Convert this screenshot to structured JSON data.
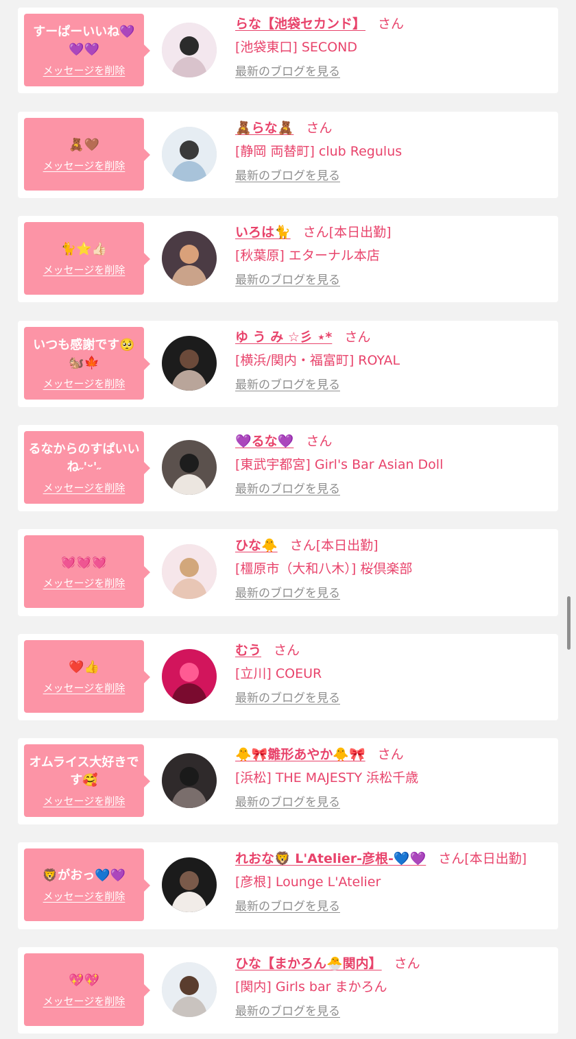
{
  "items": [
    {
      "message": "すーぱーいいね💜💜💜",
      "delete_label": "メッセージを削除",
      "name": "らな【池袋セカンド】",
      "san": "さん",
      "status": "",
      "shop": "[池袋東口] SECOND",
      "blog_link": "最新のブログを見る",
      "avatar_icon": "profile-photo"
    },
    {
      "message": "🧸🤎",
      "delete_label": "メッセージを削除",
      "name": "🧸らな🧸",
      "san": "さん",
      "status": "",
      "shop": "[静岡 両替町] club Regulus",
      "blog_link": "最新のブログを見る",
      "avatar_icon": "profile-photo"
    },
    {
      "message": "🐈⭐👍🏻",
      "delete_label": "メッセージを削除",
      "name": "いろは🐈",
      "san": "さん",
      "status": "[本日出勤]",
      "shop": "[秋葉原] エターナル本店",
      "blog_link": "最新のブログを見る",
      "avatar_icon": "profile-photo"
    },
    {
      "message": "いつも感謝です🥺🐿️🍁",
      "delete_label": "メッセージを削除",
      "name": "ゆ う み ☆彡 ⋆*",
      "san": "さん",
      "status": "",
      "shop": "[横浜/関内・福富町] ROYAL",
      "blog_link": "最新のブログを見る",
      "avatar_icon": "profile-photo"
    },
    {
      "message": "るなからのすぱいいね˶'ᵕ'˶",
      "delete_label": "メッセージを削除",
      "name": "💜るな💜",
      "san": "さん",
      "status": "",
      "shop": "[東武宇都宮] Girl's Bar Asian Doll",
      "blog_link": "最新のブログを見る",
      "avatar_icon": "profile-photo"
    },
    {
      "message": "💓💓💓",
      "delete_label": "メッセージを削除",
      "name": "ひな🐥",
      "san": "さん",
      "status": "[本日出勤]",
      "shop": "[橿原市（大和八木）] 桜倶楽部",
      "blog_link": "最新のブログを見る",
      "avatar_icon": "profile-photo"
    },
    {
      "message": "❤️👍",
      "delete_label": "メッセージを削除",
      "name": "むう",
      "san": "さん",
      "status": "",
      "shop": "[立川] COEUR",
      "blog_link": "最新のブログを見る",
      "avatar_icon": "profile-photo"
    },
    {
      "message": "オムライス大好きです🥰",
      "delete_label": "メッセージを削除",
      "name": "🐥🎀雛形あやか🐥🎀",
      "san": "さん",
      "status": "",
      "shop": "[浜松] THE MAJESTY 浜松千歳",
      "blog_link": "最新のブログを見る",
      "avatar_icon": "profile-photo"
    },
    {
      "message": "🦁がおっ💙💜",
      "delete_label": "メッセージを削除",
      "name": "れおな🦁 L'Atelier-彦根-💙💜",
      "san": "さん",
      "status": "[本日出勤]",
      "shop": "[彦根] Lounge L'Atelier",
      "blog_link": "最新のブログを見る",
      "avatar_icon": "profile-photo"
    },
    {
      "message": "💖💖",
      "delete_label": "メッセージを削除",
      "name": "ひな【まかろん🐣関内】",
      "san": "さん",
      "status": "",
      "shop": "[関内] Girls bar まかろん",
      "blog_link": "最新のブログを見る",
      "avatar_icon": "profile-photo"
    }
  ],
  "colors": {
    "accent": "#e8436b",
    "bubble": "#fc94a6",
    "link_gray": "#8e8e8e",
    "background": "#f2f2f2"
  }
}
